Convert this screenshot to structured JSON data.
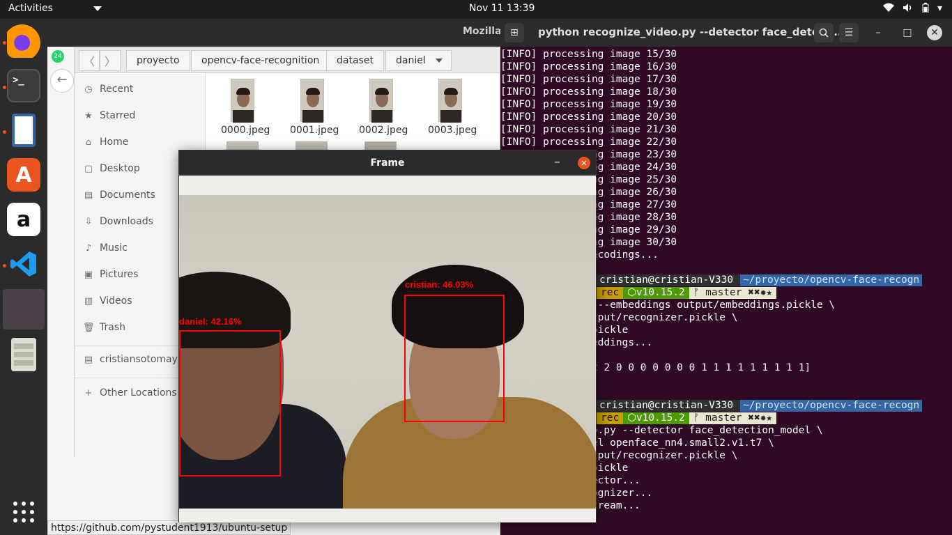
{
  "topbar": {
    "activities": "Activities",
    "clock": "Nov 11  13:39"
  },
  "dock": {
    "items": [
      "firefox-icon",
      "terminal-icon",
      "files-icon",
      "software-icon",
      "amazon-icon",
      "vscode-icon",
      "active-window-icon",
      "storage-icon",
      "app-grid-icon"
    ]
  },
  "firefox": {
    "title": "Mozilla",
    "status_url": "https://github.com/pystudent1913/ubuntu-setup"
  },
  "files": {
    "breadcrumbs": [
      "proyecto",
      "opencv-face-recognition",
      "dataset",
      "daniel"
    ],
    "sidebar": [
      {
        "label": "Recent",
        "icon": "clock-icon"
      },
      {
        "label": "Starred",
        "icon": "star-icon"
      },
      {
        "label": "Home",
        "icon": "home-icon"
      },
      {
        "label": "Desktop",
        "icon": "desktop-icon"
      },
      {
        "label": "Documents",
        "icon": "documents-icon"
      },
      {
        "label": "Downloads",
        "icon": "downloads-icon"
      },
      {
        "label": "Music",
        "icon": "music-icon"
      },
      {
        "label": "Pictures",
        "icon": "pictures-icon"
      },
      {
        "label": "Videos",
        "icon": "videos-icon"
      },
      {
        "label": "Trash",
        "icon": "trash-icon"
      },
      {
        "label": "cristiansotomay",
        "icon": "drive-icon"
      },
      {
        "label": "Other Locations",
        "icon": "plus-icon"
      }
    ],
    "files": [
      "0000.jpeg",
      "0001.jpeg",
      "0002.jpeg",
      "0003.jpeg"
    ]
  },
  "terminal": {
    "title": "python recognize_video.py --detector face_detecti...",
    "lines": [
      "[INFO] processing image 15/30",
      "[INFO] processing image 16/30",
      "[INFO] processing image 17/30",
      "[INFO] processing image 18/30",
      "[INFO] processing image 19/30",
      "[INFO] processing image 20/30",
      "[INFO] processing image 21/30",
      "[INFO] processing image 22/30",
      "       processing image 23/30",
      "       processing image 24/30",
      "       processing image 25/30",
      "       processing image 26/30",
      "       processing image 27/30",
      "       processing image 28/30",
      "       processing image 29/30",
      "       processing image 30/30",
      "       ing 30 encodings..."
    ],
    "prompt1": {
      "user": "cristian@cristian-V330",
      "path": "~/proyecto/opencv-face-recogn",
      "env": "rec",
      "node": "⬡v10.15.2",
      "git": "ᚠ master ✖✖✹★"
    },
    "block1": [
      "       model.py --embeddings output/embeddings.pickle \\",
      "       nizer output/recognizer.pickle \\",
      "       tput/le.pickle",
      "       face embeddings...",
      "       labels...",
      "       2 2 2 2 2 2 0 0 0 0 0 0 0 1 1 1 1 1 1 1 1 1]",
      "        model..."
    ],
    "prompt2": {
      "user": "cristian@cristian-V330",
      "path": "~/proyecto/opencv-face-recogn",
      "env": "rec",
      "node": "⬡v10.15.2",
      "git": "ᚠ master ✖✖✹★"
    },
    "block2": [
      "       ize_video.py --detector face_detection_model \\",
      "       ding-model openface_nn4.small2.v1.t7 \\",
      "       nizer output/recognizer.pickle \\",
      "       tput/le.pickle",
      "       face detector...",
      "       face recognizer...",
      "        video stream..."
    ]
  },
  "frame": {
    "title": "Frame",
    "detections": [
      {
        "label": "daniel: 42.16%"
      },
      {
        "label": "cristian: 46.03%"
      }
    ]
  },
  "colors": {
    "ubuntu_orange": "#e95420",
    "terminal_bg": "#300a24",
    "box": "#ff0000"
  }
}
